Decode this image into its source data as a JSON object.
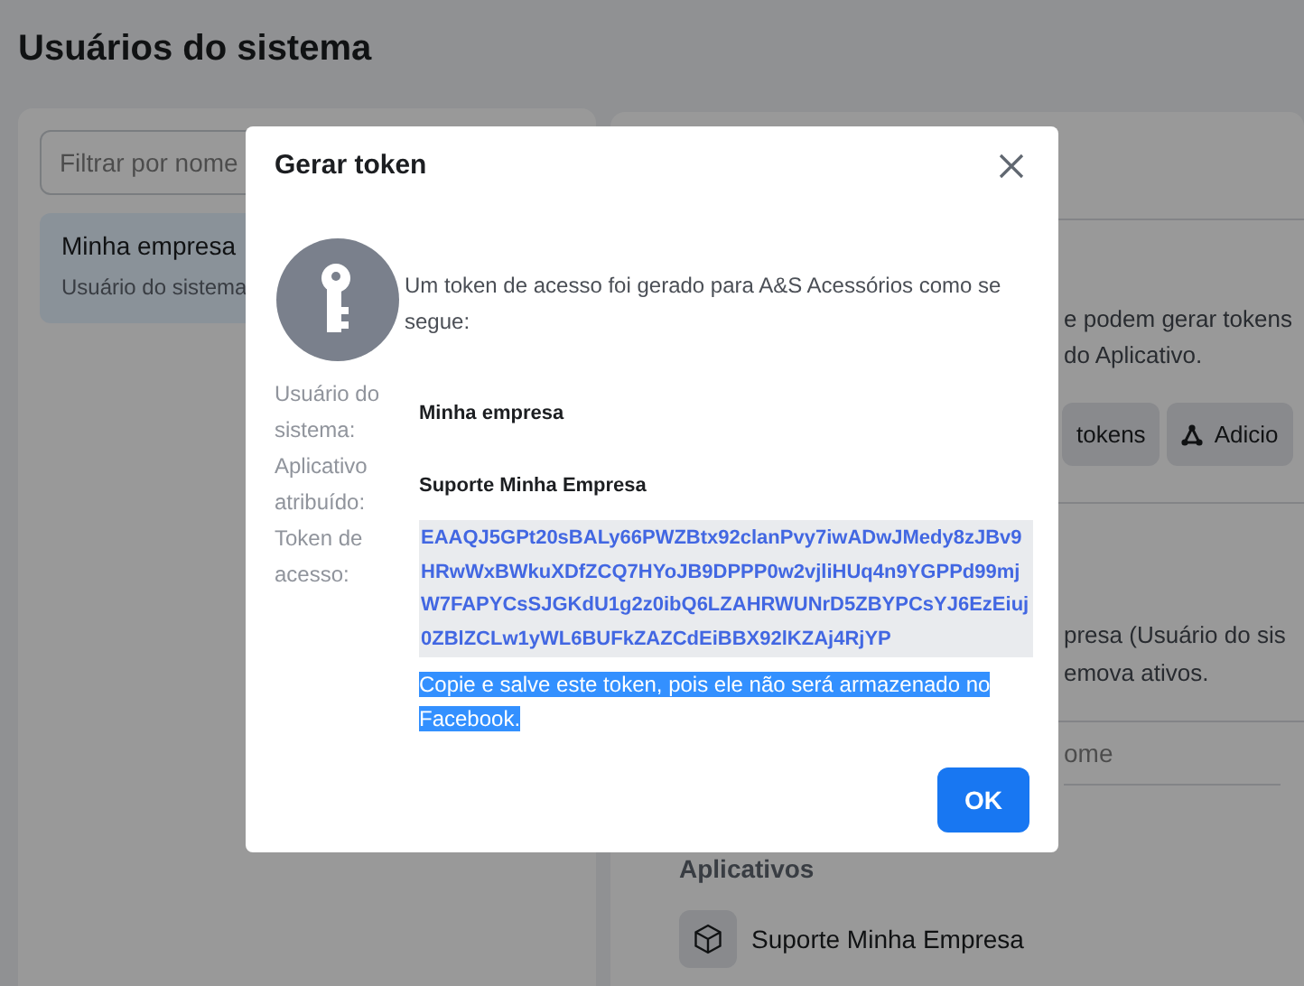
{
  "page": {
    "title": "Usuários do sistema"
  },
  "left_panel": {
    "search": {
      "placeholder": "Filtrar por nome"
    },
    "items": [
      {
        "name": "Minha empresa",
        "role": "Usuário do sistema",
        "selected": true
      }
    ]
  },
  "right_panel": {
    "intro_lines": [
      "e podem gerar tokens",
      "do Aplicativo."
    ],
    "buttons": [
      {
        "label": "tokens"
      },
      {
        "label": "Adicio"
      }
    ],
    "detail_lines": [
      "presa (Usuário do sis",
      "emova ativos."
    ],
    "filter": {
      "placeholder": "ome"
    },
    "apps_heading": "Aplicativos",
    "apps": [
      {
        "name": "Suporte Minha Empresa"
      }
    ]
  },
  "dialog": {
    "title": "Gerar token",
    "message": "Um token de acesso foi gerado para A&S Acessórios como se segue:",
    "fields": [
      {
        "label": "Usuário do sistema:",
        "value": "Minha empresa",
        "kind": "text"
      },
      {
        "label": "Aplicativo atribuído:",
        "value": "Suporte Minha Empresa",
        "kind": "text"
      },
      {
        "label": "Token de acesso:",
        "value": "EAAQJ5GPt20sBALy66PWZBtx92clanPvy7iwADwJMedy8zJBv9HRwWxBWkuXDfZCQ7HYoJB9DPPP0w2vjliHUq4n9YGPPd99mjW7FAPYCsSJGKdU1g2z0ibQ6LZAHRWUNrD5ZBYPCsYJ6EzEiuj0ZBlZCLw1yWL6BUFkZAZCdEiBBX92lKZAj4RjYP",
        "kind": "token"
      }
    ],
    "warning": {
      "text": "Copie e salve este token, pois ele não será armazenado no Facebook.",
      "highlighted": true
    },
    "ok_button": "OK"
  }
}
